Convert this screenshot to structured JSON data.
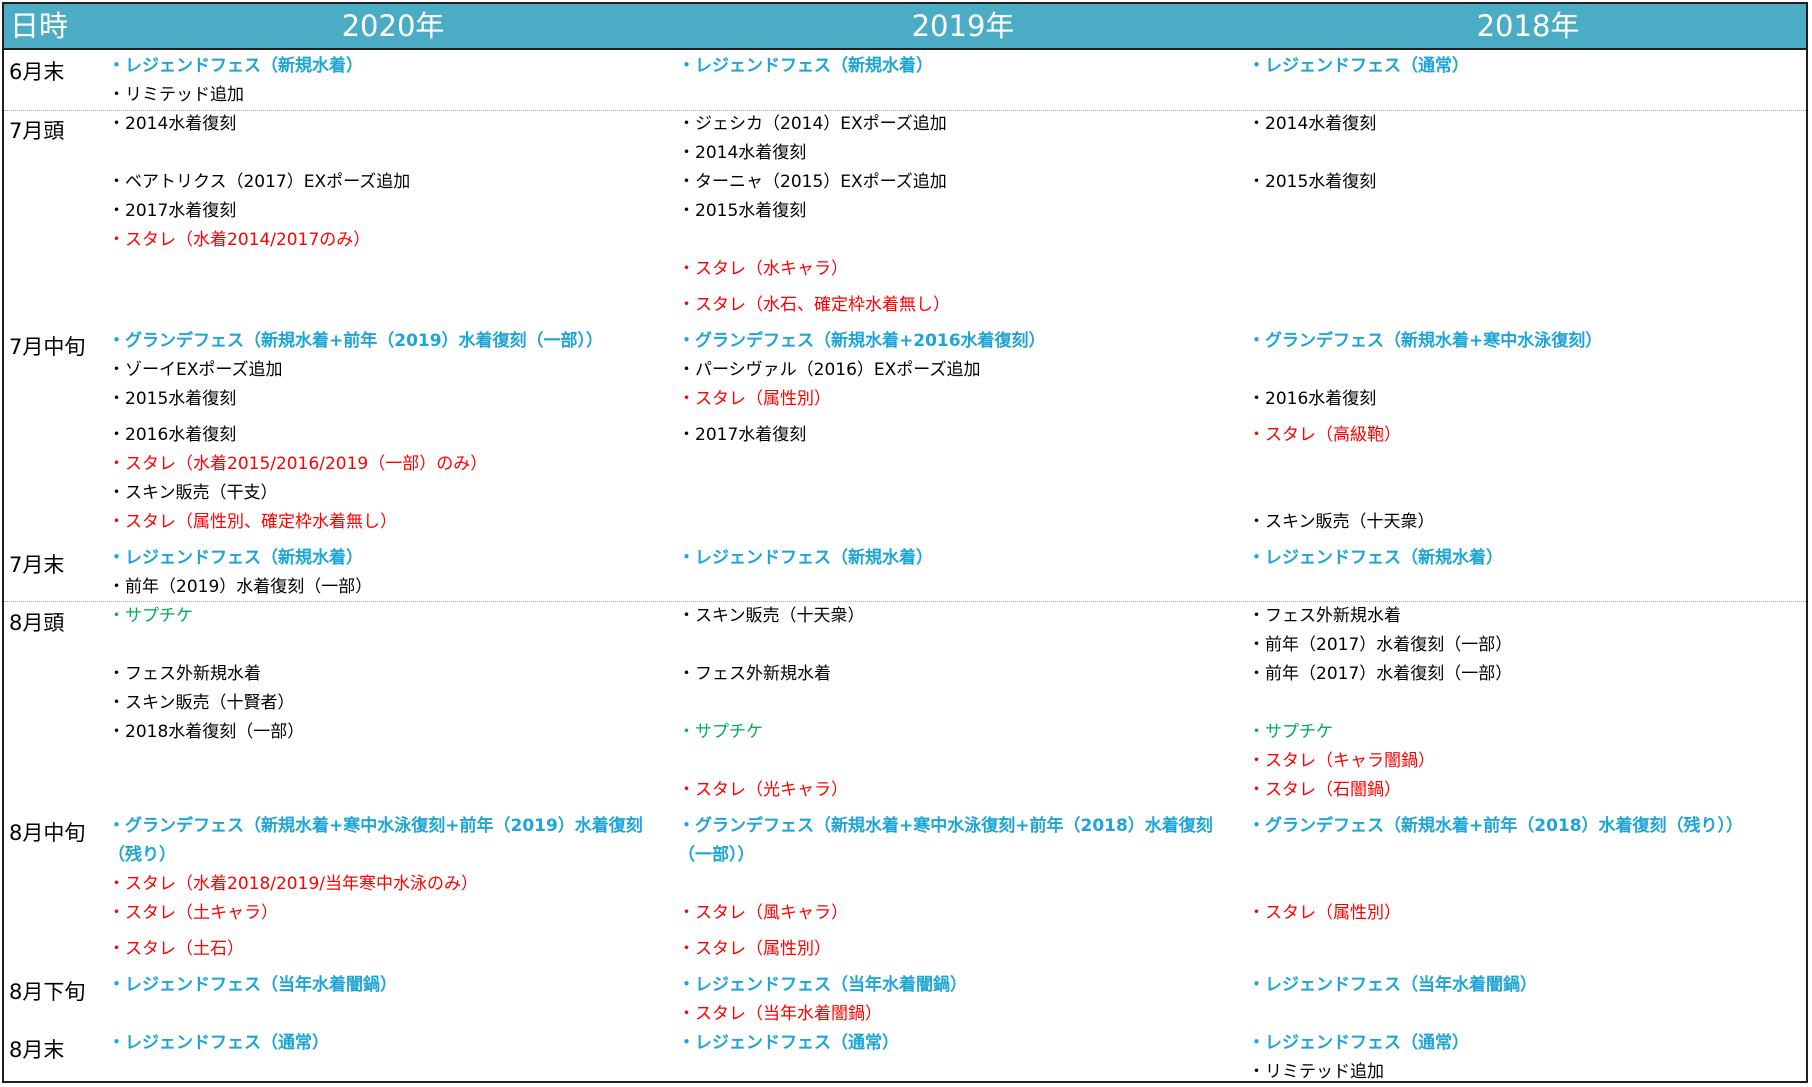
{
  "header": {
    "date": "日時",
    "col2020": "2020年",
    "col2019": "2019年",
    "col2018": "2018年"
  },
  "colors": {
    "header_bg": "#4bacc6",
    "fes": "#1ea5d8",
    "stall": "#ff0000",
    "ticket": "#00b050",
    "normal": "#000000"
  },
  "periods": {
    "p_jun_end": "6月末",
    "p_jul_start": "7月頭",
    "p_jul_mid": "7月中旬",
    "p_jul_end": "7月末",
    "p_aug_start": "8月頭",
    "p_aug_mid": "8月中旬",
    "p_aug_late": "8月下旬",
    "p_aug_end": "8月末"
  },
  "rows": {
    "jun_end": {
      "y2020": [
        "・レジェンドフェス（新規水着）",
        "・リミテッド追加"
      ],
      "y2019": [
        "・レジェンドフェス（新規水着）"
      ],
      "y2018": [
        "・レジェンドフェス（通常）"
      ]
    },
    "jul_start": {
      "y2020": [
        "・2014水着復刻",
        "・ベアトリクス（2017）EXポーズ追加",
        "・2017水着復刻",
        "・スタレ（水着2014/2017のみ）"
      ],
      "y2019": [
        "・ジェシカ（2014）EXポーズ追加",
        "・2014水着復刻",
        "・ターニャ（2015）EXポーズ追加",
        "・2015水着復刻",
        "・スタレ（水キャラ）",
        "・スタレ（水石、確定枠水着無し）"
      ],
      "y2018": [
        "・2014水着復刻",
        "・2015水着復刻"
      ]
    },
    "jul_mid": {
      "y2020": [
        "・グランデフェス（新規水着+前年（2019）水着復刻（一部））",
        "・ゾーイEXポーズ追加",
        "・2015水着復刻",
        "・2016水着復刻",
        "・スタレ（水着2015/2016/2019（一部）のみ）",
        "・スキン販売（干支）",
        "・スタレ（属性別、確定枠水着無し）"
      ],
      "y2019": [
        "・グランデフェス（新規水着+2016水着復刻）",
        "・パーシヴァル（2016）EXポーズ追加",
        "・スタレ（属性別）",
        "・2017水着復刻"
      ],
      "y2018": [
        "・グランデフェス（新規水着+寒中水泳復刻）",
        "・2016水着復刻",
        "・スタレ（高級鞄）",
        "・スキン販売（十天衆）"
      ]
    },
    "jul_end": {
      "y2020": [
        "・レジェンドフェス（新規水着）",
        "・前年（2019）水着復刻（一部）"
      ],
      "y2019": [
        "・レジェンドフェス（新規水着）"
      ],
      "y2018": [
        "・レジェンドフェス（新規水着）"
      ]
    },
    "aug_start": {
      "y2020": [
        "・サプチケ",
        "・フェス外新規水着",
        "・スキン販売（十賢者）",
        "・2018水着復刻（一部）"
      ],
      "y2019": [
        "・スキン販売（十天衆）",
        "・フェス外新規水着",
        "・サプチケ",
        "・スタレ（光キャラ）"
      ],
      "y2018": [
        "・フェス外新規水着",
        "・前年（2017）水着復刻（一部）",
        "・前年（2017）水着復刻（一部）",
        "・サプチケ",
        "・スタレ（キャラ闇鍋）",
        "・スタレ（石闇鍋）"
      ]
    },
    "aug_mid": {
      "y2020": [
        "・グランデフェス（新規水着+寒中水泳復刻+前年（2019）水着復刻（残り）",
        "・スタレ（水着2018/2019/当年寒中水泳のみ）",
        "・スタレ（土キャラ）",
        "・スタレ（土石）"
      ],
      "y2019": [
        "・グランデフェス（新規水着+寒中水泳復刻+前年（2018）水着復刻（一部））",
        "・スタレ（風キャラ）",
        "・スタレ（属性別）"
      ],
      "y2018": [
        "・グランデフェス（新規水着+前年（2018）水着復刻（残り））",
        "・スタレ（属性別）"
      ]
    },
    "aug_late": {
      "y2020": [
        "・レジェンドフェス（当年水着闇鍋）"
      ],
      "y2019": [
        "・レジェンドフェス（当年水着闇鍋）",
        "・スタレ（当年水着闇鍋）"
      ],
      "y2018": [
        "・レジェンドフェス（当年水着闇鍋）"
      ]
    },
    "aug_end": {
      "y2020": [
        "・レジェンドフェス（通常）"
      ],
      "y2019": [
        "・レジェンドフェス（通常）"
      ],
      "y2018": [
        "・レジェンドフェス（通常）",
        "・リミテッド追加"
      ]
    }
  }
}
